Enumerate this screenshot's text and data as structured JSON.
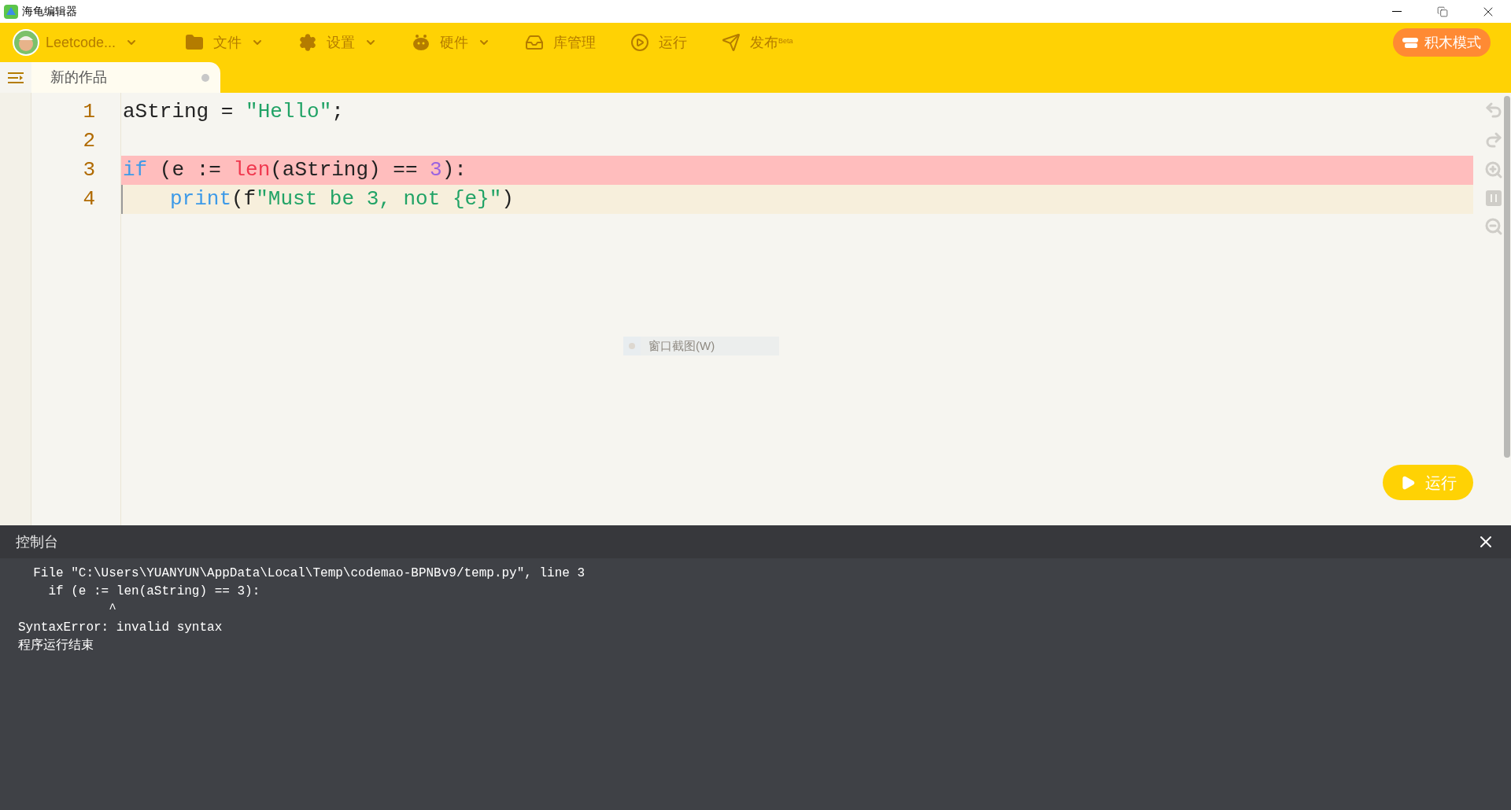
{
  "window": {
    "title": "海龟编辑器"
  },
  "toolbar": {
    "project": {
      "label": "Leetcode..."
    },
    "menus": [
      {
        "kind": "folder",
        "label": "文件",
        "dropdown": true
      },
      {
        "kind": "gear",
        "label": "设置",
        "dropdown": true
      },
      {
        "kind": "hardware",
        "label": "硬件",
        "dropdown": true
      },
      {
        "kind": "library",
        "label": "库管理",
        "dropdown": false
      },
      {
        "kind": "run",
        "label": "运行",
        "dropdown": false
      },
      {
        "kind": "publish",
        "label": "发布$^{Beta}$",
        "dropdown": false
      }
    ],
    "mode_button": "积木模式"
  },
  "tabs": [
    {
      "label": "新的作品",
      "selected": true,
      "unsaved": true
    }
  ],
  "editor": {
    "lines": [
      {
        "number": "1",
        "error": false,
        "current": false,
        "indented": false,
        "tokens": [
          {
            "text": "aString = ",
            "kind": "plain"
          },
          {
            "text": "\"Hello\"",
            "kind": "string"
          },
          {
            "text": ";",
            "kind": "plain"
          }
        ]
      },
      {
        "number": "2",
        "error": false,
        "current": false
      },
      {
        "number": "3",
        "error": true,
        "current": false,
        "indented": false,
        "tokens": [
          {
            "text": "if",
            "kind": "keyword"
          },
          {
            "text": " (e := ",
            "kind": "plain"
          },
          {
            "text": "len",
            "kind": "builtin"
          },
          {
            "text": "(aString) == ",
            "kind": "plain"
          },
          {
            "text": "3",
            "kind": "number"
          },
          {
            "text": "):",
            "kind": "plain"
          }
        ]
      },
      {
        "number": "4",
        "error": false,
        "current": true,
        "indented": true,
        "tokens": [
          {
            "text": "print",
            "kind": "function"
          },
          {
            "text": "(f",
            "kind": "plain"
          },
          {
            "text": "\"Must be 3, not {e}\"",
            "kind": "string"
          },
          {
            "text": ")",
            "kind": "plain"
          }
        ]
      }
    ],
    "context_hint": "窗口截图(W)",
    "run_button": "运行"
  },
  "console": {
    "title": "控制台",
    "lines": [
      "  File \"C:\\Users\\YUANYUN\\AppData\\Local\\Temp\\codemao-BPNBv9/temp.py\", line 3",
      "    if (e := len(aString) == 3):",
      "            ^",
      "SyntaxError: invalid syntax",
      "程序运行结束"
    ]
  }
}
